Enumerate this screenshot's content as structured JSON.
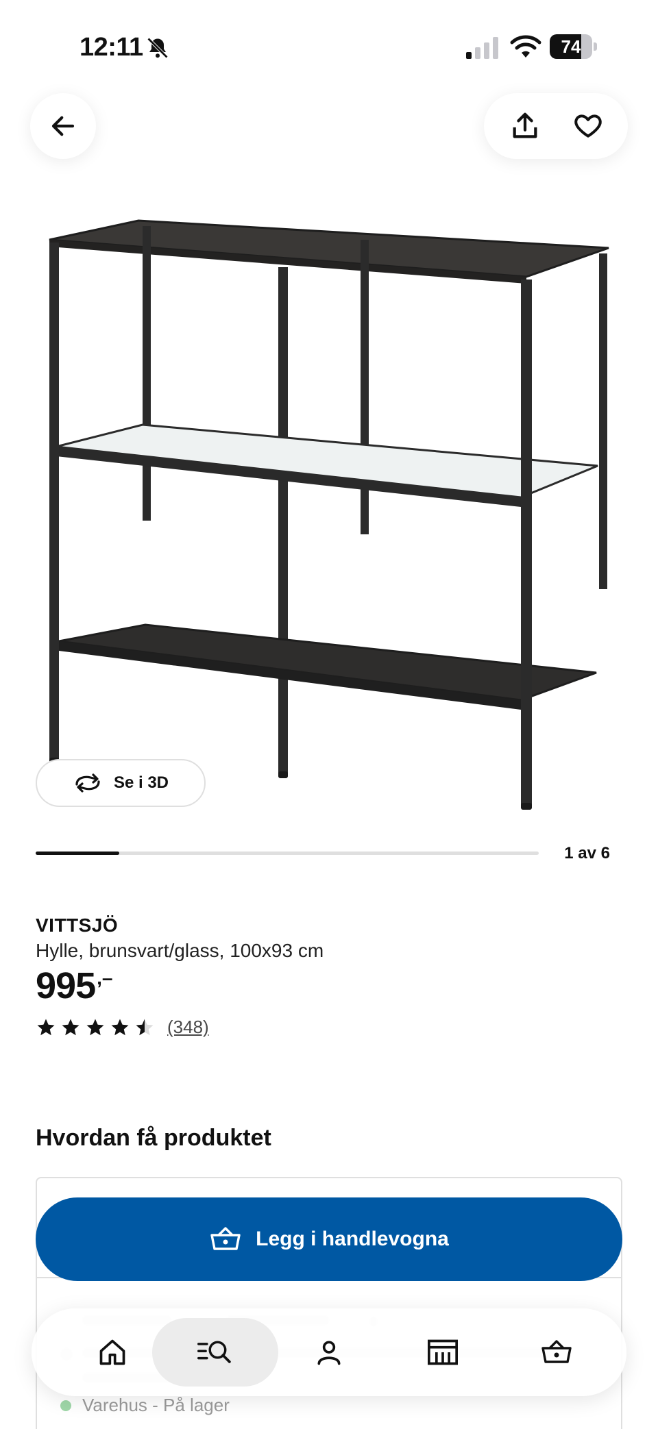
{
  "status_bar": {
    "time": "12:11",
    "battery": "74",
    "battery_level": 0.74
  },
  "product": {
    "name": "VITTSJÖ",
    "description": "Hylle, brunsvart/glass, 100x93 cm",
    "price": "995",
    "price_suffix": ",–",
    "rating": 4.5,
    "review_count": "(348)"
  },
  "gallery": {
    "view_3d_label": "Se i 3D",
    "counter": "1 av 6",
    "current": 1,
    "total": 6
  },
  "delivery": {
    "title": "Hvordan få produktet",
    "add_to_cart_label": "Legg i handlevogna",
    "store_stock": "Varehus - På lager"
  },
  "nav": {
    "items": [
      {
        "icon": "home-icon"
      },
      {
        "icon": "search-icon",
        "active": true
      },
      {
        "icon": "profile-icon"
      },
      {
        "icon": "store-icon"
      },
      {
        "icon": "cart-icon"
      }
    ]
  },
  "colors": {
    "primary_blue": "#0058a3",
    "stock_green": "#9fd7a8",
    "text": "#111111"
  }
}
